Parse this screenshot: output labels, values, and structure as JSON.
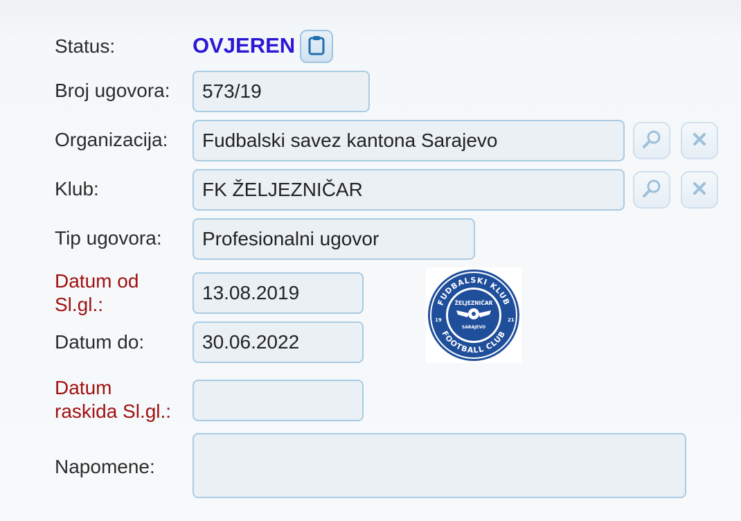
{
  "status": {
    "label": "Status:",
    "value": "OVJEREN",
    "value_color": "#2b17d6"
  },
  "fields": {
    "broj_ugovora": {
      "label": "Broj ugovora:",
      "value": "573/19"
    },
    "organizacija": {
      "label": "Organizacija:",
      "value": "Fudbalski savez kantona Sarajevo"
    },
    "klub": {
      "label": "Klub:",
      "value": "FK ŽELJEZNIČAR"
    },
    "tip_ugovora": {
      "label": "Tip ugovora:",
      "value": "Profesionalni ugovor"
    },
    "datum_od": {
      "label_line1": "Datum od",
      "label_line2": "Sl.gl.:",
      "value": "13.08.2019",
      "required": true
    },
    "datum_do": {
      "label": "Datum do:",
      "value": "30.06.2022"
    },
    "datum_raskida": {
      "label_line1": "Datum",
      "label_line2": "raskida Sl.gl.:",
      "value": "",
      "required": true
    },
    "napomene": {
      "label": "Napomene:",
      "value": ""
    }
  },
  "logo": {
    "top_text": "FUDBALSKI KLUB",
    "bottom_text": "FOOTBALL CLUB",
    "name": "ŽELJEZNIČAR",
    "city": "SARAJEVO",
    "year_left": "19",
    "year_right": "21"
  },
  "colors": {
    "required_label": "#a01010",
    "field_border": "#a9cbe4",
    "field_bg": "#eaf0f4"
  },
  "icons": {
    "status_action": "clipboard-icon",
    "search": "search-icon",
    "clear": "close-icon"
  }
}
